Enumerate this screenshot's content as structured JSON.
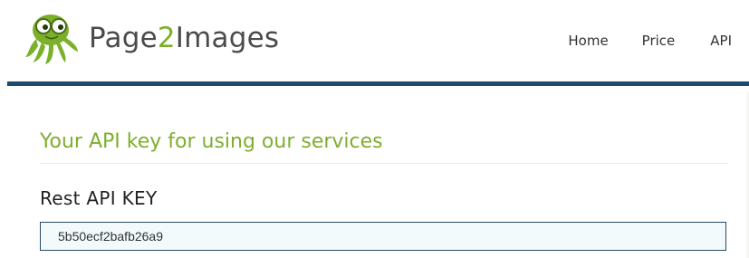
{
  "header": {
    "brand": {
      "prefix": "Page",
      "highlight": "2",
      "suffix": "Images",
      "icon": "octopus-logo-icon",
      "accent_color": "#7bb02a"
    },
    "nav": [
      {
        "label": "Home"
      },
      {
        "label": "Price"
      },
      {
        "label": "API"
      }
    ],
    "rule_color": "#1e4b6c"
  },
  "main": {
    "section_title": "Your API key for using our services",
    "section_title_color": "#7fae2e",
    "field_label": "Rest API KEY",
    "api_key_value": "5b50ecf2bafb26a9"
  }
}
